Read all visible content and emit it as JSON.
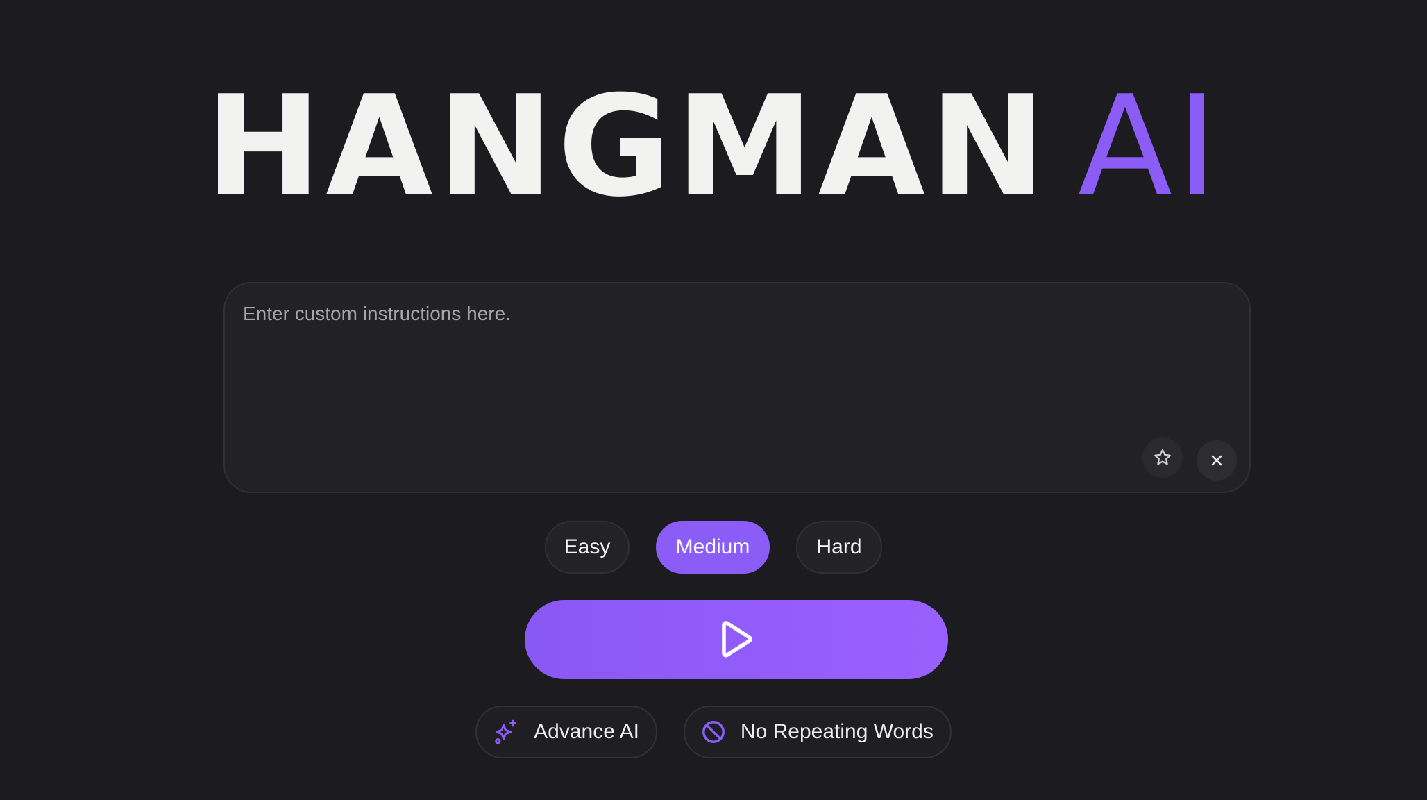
{
  "title": {
    "main": "HANGMAN",
    "accent": "AI"
  },
  "prompt": {
    "placeholder": "Enter custom instructions here.",
    "value": ""
  },
  "prompt_actions": {
    "favorite_icon": "star-icon",
    "clear_icon": "close-icon"
  },
  "difficulty": {
    "options": [
      "Easy",
      "Medium",
      "Hard"
    ],
    "selected": "Medium"
  },
  "play_button": {
    "icon": "play-icon"
  },
  "toggles": {
    "advance_ai": {
      "label": "Advance AI",
      "icon": "sparkles-icon"
    },
    "no_repeat": {
      "label": "No Repeating Words",
      "icon": "ban-icon"
    }
  },
  "colors": {
    "background": "#1c1c20",
    "accent": "#8b5cf6",
    "title_text": "#f2f2f0"
  }
}
